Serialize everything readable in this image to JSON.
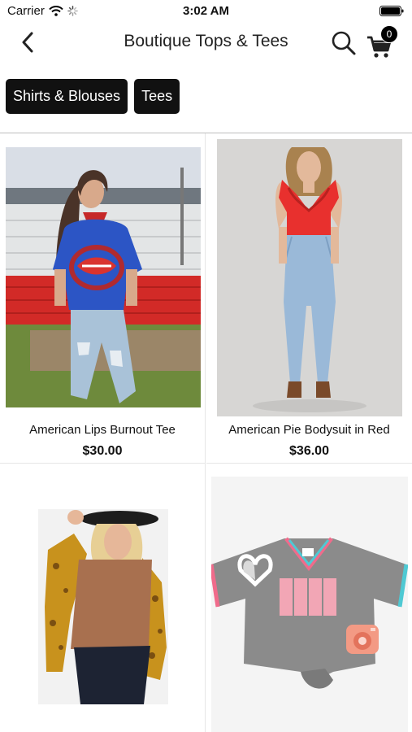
{
  "status_bar": {
    "carrier": "Carrier",
    "time": "3:02 AM",
    "icons": [
      "wifi-icon",
      "loading-spinner-icon",
      "battery-icon"
    ]
  },
  "nav": {
    "title": "Boutique Tops & Tees",
    "back_icon": "chevron-left-icon",
    "search_icon": "search-icon",
    "cart_icon": "cart-icon",
    "cart_count": "0"
  },
  "categories": [
    {
      "label": "Shirts & Blouses"
    },
    {
      "label": "Tees"
    }
  ],
  "products": [
    {
      "name": "American Lips Burnout Tee",
      "price": "$30.00"
    },
    {
      "name": "American Pie Bodysuit in Red",
      "price": "$36.00"
    },
    {
      "name": "",
      "price": ""
    },
    {
      "name": "",
      "price": ""
    }
  ],
  "colors": {
    "accent": "#111111",
    "badge": "#000000",
    "divider": "#bdbdbd"
  }
}
